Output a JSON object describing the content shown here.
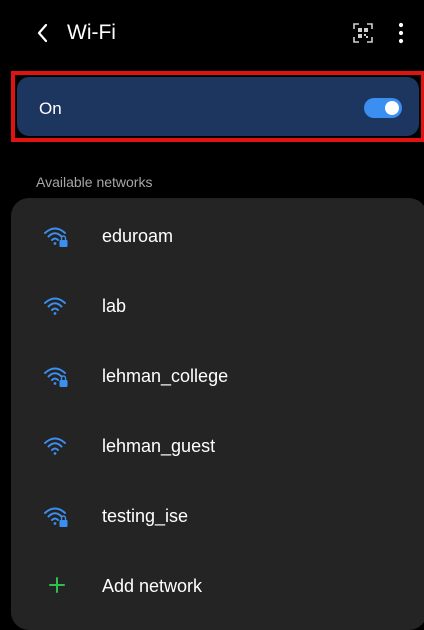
{
  "header": {
    "title": "Wi-Fi",
    "back_icon": "chevron-left-icon",
    "qr_icon": "qr-scan-icon",
    "more_icon": "more-vertical-icon"
  },
  "toggle": {
    "label": "On",
    "state": "on",
    "accent": "#3b8ff0"
  },
  "section_title": "Available networks",
  "networks": [
    {
      "name": "eduroam",
      "secured": true
    },
    {
      "name": "lab",
      "secured": false
    },
    {
      "name": "lehman_college",
      "secured": true
    },
    {
      "name": "lehman_guest",
      "secured": false
    },
    {
      "name": "testing_ise",
      "secured": true
    }
  ],
  "add_network": {
    "label": "Add network",
    "icon": "plus-icon",
    "color": "#2fbf4f"
  },
  "colors": {
    "wifi_icon": "#3b8ff0",
    "highlight_border": "#e01212"
  }
}
